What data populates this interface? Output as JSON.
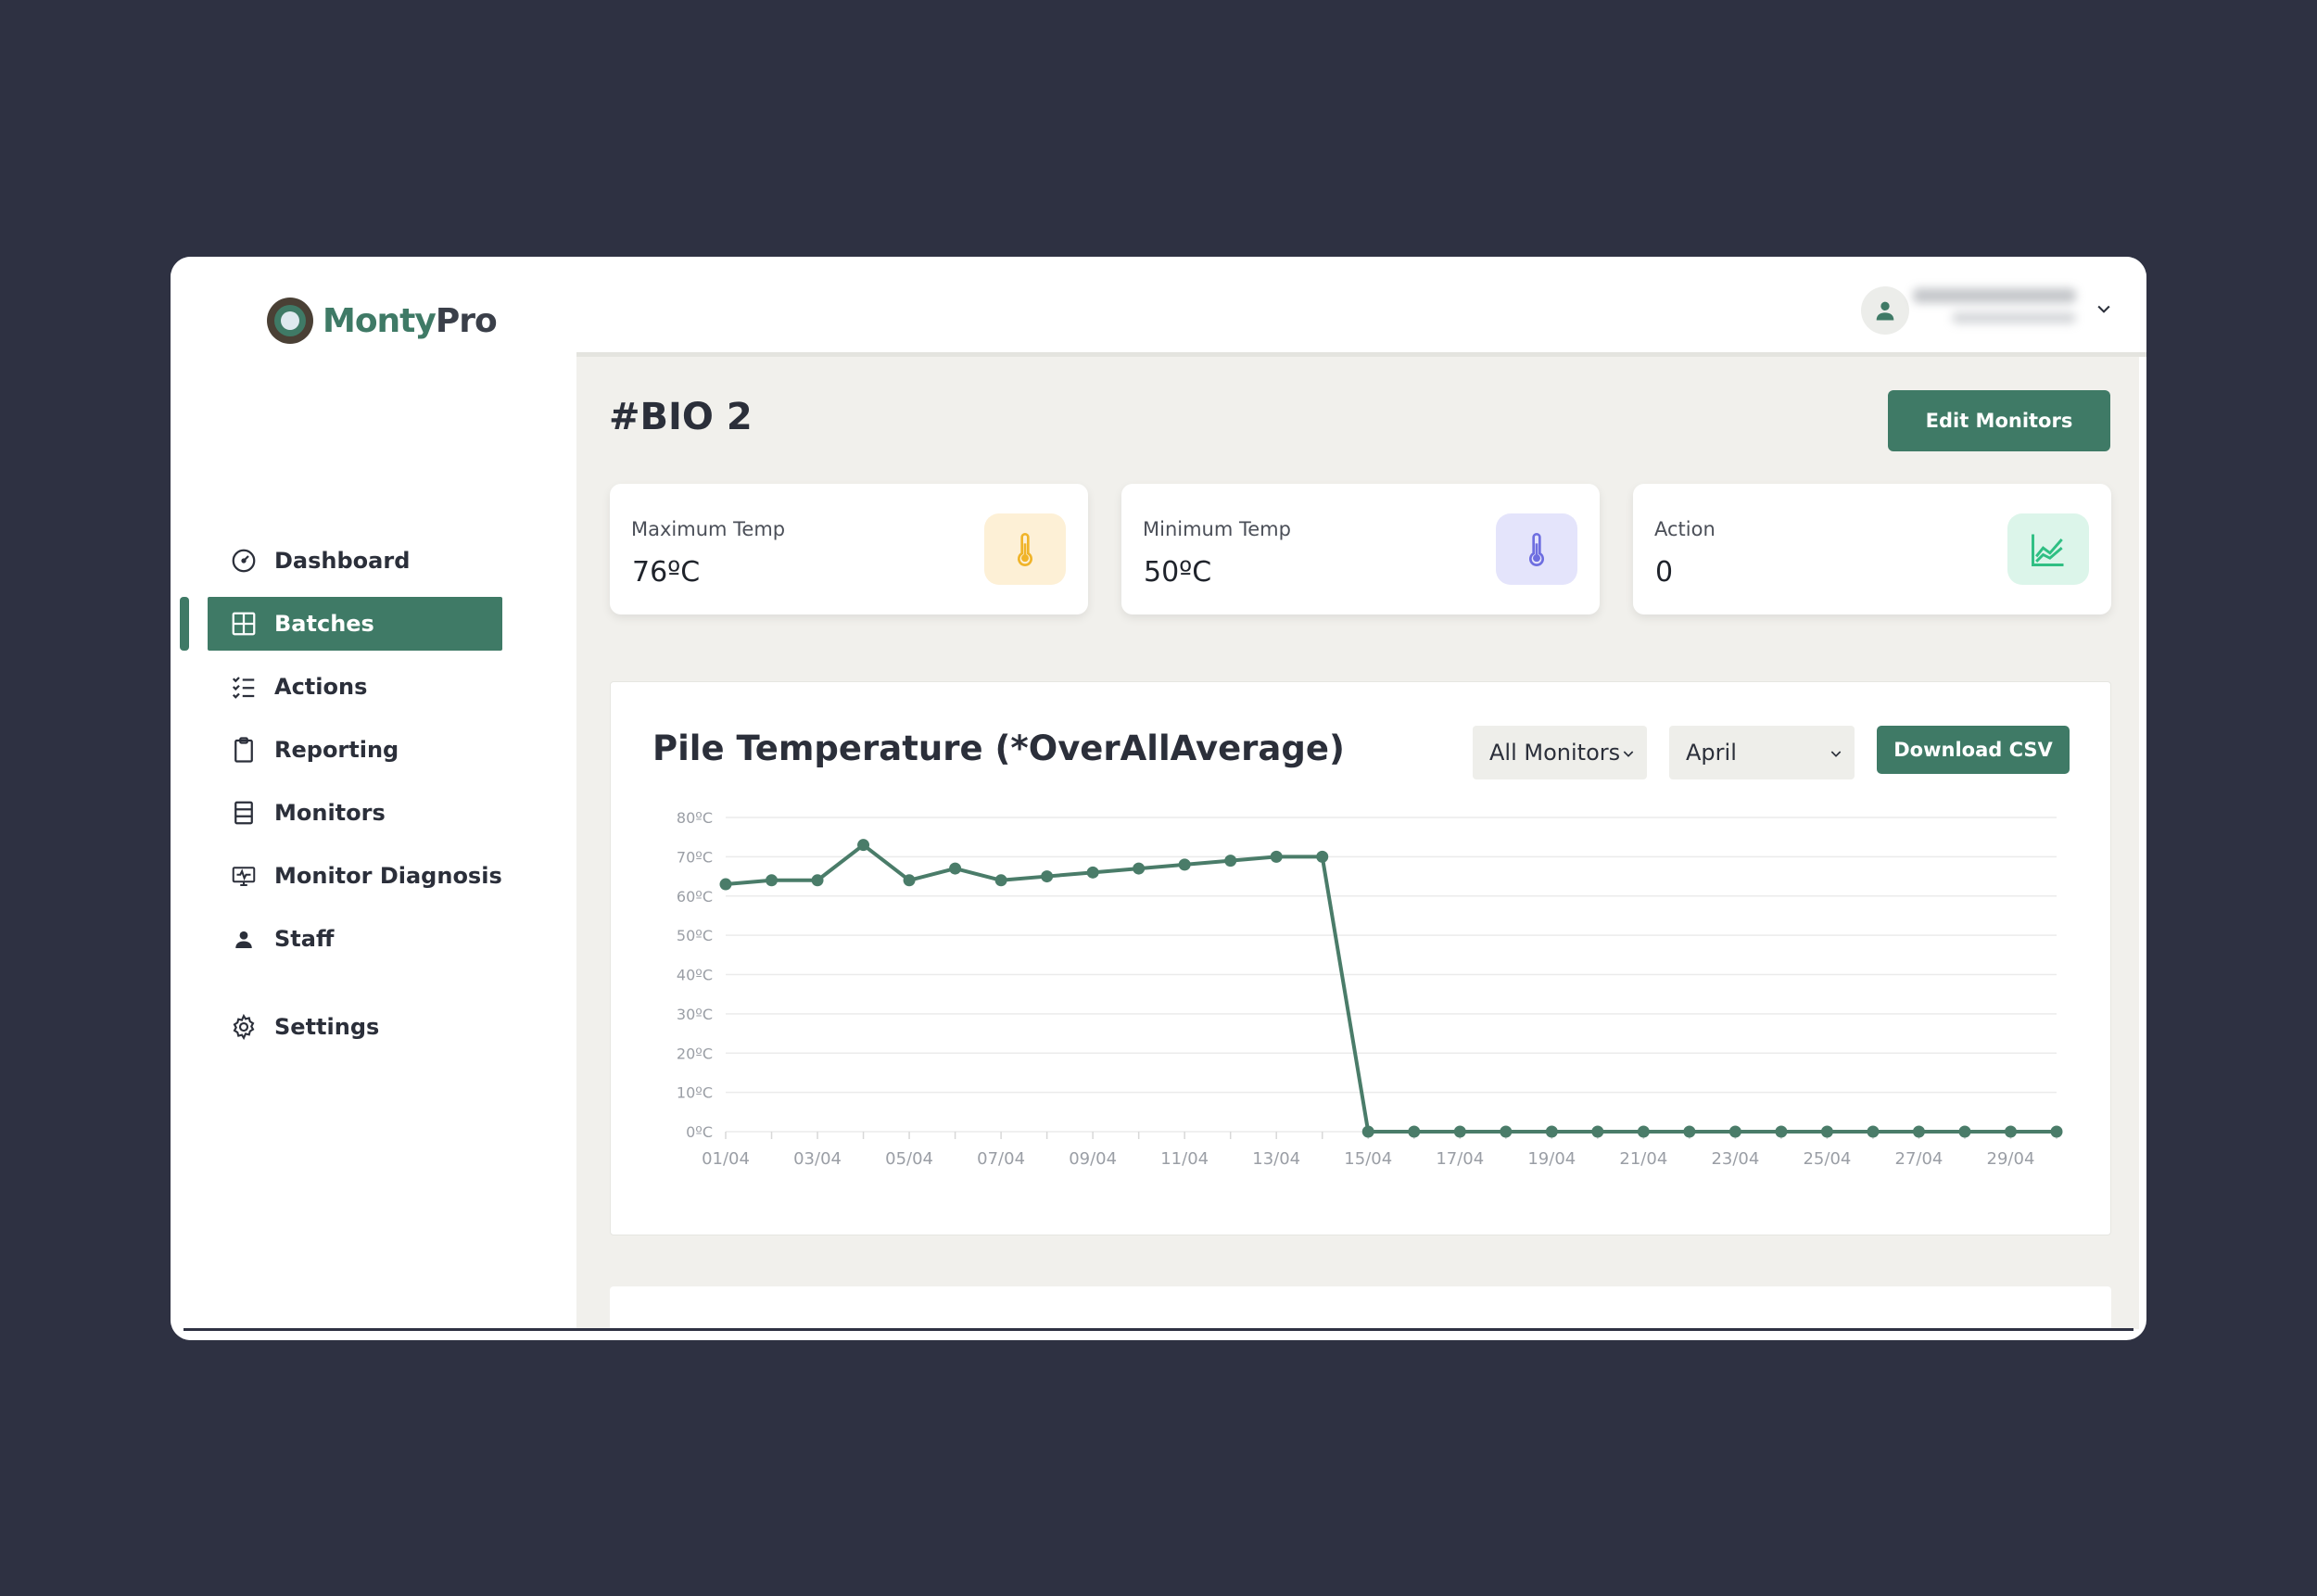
{
  "app": {
    "logo_part1": "Monty",
    "logo_part2": "Pro"
  },
  "sidebar": {
    "items": [
      {
        "label": "Dashboard",
        "icon": "gauge-icon"
      },
      {
        "label": "Batches",
        "icon": "grid-icon",
        "active": true
      },
      {
        "label": "Actions",
        "icon": "checklist-icon"
      },
      {
        "label": "Reporting",
        "icon": "clipboard-icon"
      },
      {
        "label": "Monitors",
        "icon": "monitor-list-icon"
      },
      {
        "label": "Monitor Diagnosis",
        "icon": "diagnosis-icon"
      },
      {
        "label": "Staff",
        "icon": "person-icon"
      },
      {
        "label": "Settings",
        "icon": "gear-icon"
      }
    ]
  },
  "topbar": {
    "avatar_icon": "user-icon",
    "menu_icon": "chevron-down-icon"
  },
  "page": {
    "title": "#BIO 2",
    "edit_monitors_label": "Edit Monitors"
  },
  "stats": [
    {
      "label": "Maximum Temp",
      "value": "76ºC",
      "icon": "thermometer-icon",
      "icon_bg": "#fdf0d6",
      "icon_color": "#f0b429"
    },
    {
      "label": "Minimum Temp",
      "value": "50ºC",
      "icon": "thermometer-icon",
      "icon_bg": "#e4e4fb",
      "icon_color": "#6e6ee0"
    },
    {
      "label": "Action",
      "value": "0",
      "icon": "trend-chart-icon",
      "icon_bg": "#dcf5ea",
      "icon_color": "#2fbf83"
    }
  ],
  "chart_panel": {
    "title": "Pile Temperature (*OverAllAverage)",
    "monitor_select": "All Monitors",
    "month_select": "April",
    "download_label": "Download CSV"
  },
  "chart_data": {
    "type": "line",
    "x": [
      "01/04",
      "02/04",
      "03/04",
      "04/04",
      "05/04",
      "06/04",
      "07/04",
      "08/04",
      "09/04",
      "10/04",
      "11/04",
      "12/04",
      "13/04",
      "14/04",
      "15/04",
      "16/04",
      "17/04",
      "18/04",
      "19/04",
      "20/04",
      "21/04",
      "22/04",
      "23/04",
      "24/04",
      "25/04",
      "26/04",
      "27/04",
      "28/04",
      "29/04",
      "30/04"
    ],
    "x_tick_labels": [
      "01/04",
      "03/04",
      "05/04",
      "07/04",
      "09/04",
      "11/04",
      "13/04",
      "15/04",
      "17/04",
      "19/04",
      "21/04",
      "23/04",
      "25/04",
      "27/04",
      "29/04"
    ],
    "y_ticks": [
      "0ºC",
      "10ºC",
      "20ºC",
      "30ºC",
      "40ºC",
      "50ºC",
      "60ºC",
      "70ºC",
      "80ºC"
    ],
    "ylim": [
      0,
      80
    ],
    "values": [
      63,
      64,
      64,
      73,
      64,
      67,
      64,
      65,
      66,
      67,
      68,
      69,
      70,
      70,
      0,
      0,
      0,
      0,
      0,
      0,
      0,
      0,
      0,
      0,
      0,
      0,
      0,
      0,
      0,
      0
    ],
    "line_color": "#4a7c69",
    "grid": true
  }
}
